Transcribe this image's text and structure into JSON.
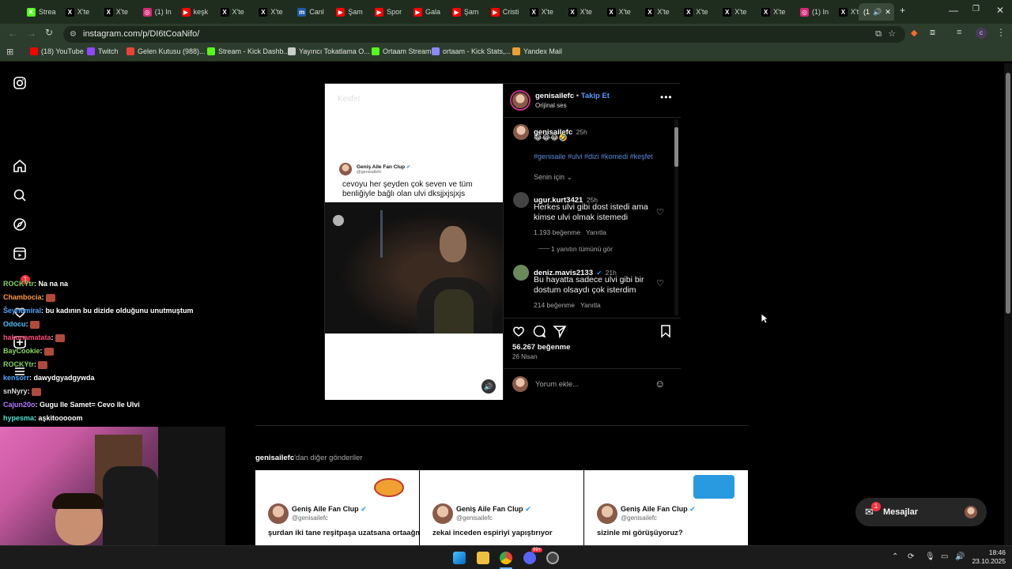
{
  "browser": {
    "tabs": [
      {
        "label": "Strea",
        "icon": "kick-icon",
        "color": "#53fc18"
      },
      {
        "label": "X'te",
        "icon": "x-icon",
        "color": "#000000"
      },
      {
        "label": "X'te",
        "icon": "x-icon",
        "color": "#000000"
      },
      {
        "label": "(1) In",
        "icon": "instagram-icon",
        "color": "#d62976"
      },
      {
        "label": "keşk",
        "icon": "youtube-icon",
        "color": "#ff0000"
      },
      {
        "label": "X'te",
        "icon": "x-icon",
        "color": "#000000"
      },
      {
        "label": "X'te",
        "icon": "x-icon",
        "color": "#000000"
      },
      {
        "label": "Canl",
        "icon": "mackolik-icon",
        "color": "#1e5aa8"
      },
      {
        "label": "Şam",
        "icon": "youtube-icon",
        "color": "#ff0000"
      },
      {
        "label": "Spor",
        "icon": "youtube-icon",
        "color": "#ff0000"
      },
      {
        "label": "Gala",
        "icon": "youtube-icon",
        "color": "#ff0000"
      },
      {
        "label": "Şam",
        "icon": "youtube-icon",
        "color": "#ff0000"
      },
      {
        "label": "Cristi",
        "icon": "youtube-icon",
        "color": "#ff0000"
      },
      {
        "label": "X'te",
        "icon": "x-icon",
        "color": "#000000"
      },
      {
        "label": "X'te",
        "icon": "x-icon",
        "color": "#000000"
      },
      {
        "label": "X'te",
        "icon": "x-icon",
        "color": "#000000"
      },
      {
        "label": "X'te",
        "icon": "x-icon",
        "color": "#000000"
      },
      {
        "label": "X'te",
        "icon": "x-icon",
        "color": "#000000"
      },
      {
        "label": "X'te",
        "icon": "x-icon",
        "color": "#000000"
      },
      {
        "label": "X'te",
        "icon": "x-icon",
        "color": "#000000"
      },
      {
        "label": "(1) In",
        "icon": "instagram-icon",
        "color": "#d62976"
      },
      {
        "label": "X'te",
        "icon": "x-icon",
        "color": "#000000"
      }
    ],
    "active_tab_label": "(1",
    "url": "instagram.com/p/DI6tCoaNifo/",
    "bookmarks": [
      {
        "label": "(18) YouTube",
        "color": "#ff0000"
      },
      {
        "label": "Twitch",
        "color": "#9146ff"
      },
      {
        "label": "Gelen Kutusu (988)...",
        "color": "#ea4335"
      },
      {
        "label": "Stream - Kick Dashb...",
        "color": "#53fc18"
      },
      {
        "label": "Yayıncı Tokatlama O...",
        "color": "#cccccc"
      },
      {
        "label": "Ortaam Stream",
        "color": "#53fc18"
      },
      {
        "label": "ortaam - Kick Stats,...",
        "color": "#8a8aff"
      },
      {
        "label": "Yandex Mail",
        "color": "#f0a030"
      }
    ]
  },
  "post": {
    "username": "genisailefc",
    "follow_label": "Takip Et",
    "audio": "Orijinal ses",
    "caption_time": "25h",
    "caption_emojis": "😂😂😂🤣",
    "hashtags": "#genisaile #ulvi #dizi #komedi #keşfet",
    "for_you": "Senin için",
    "comments": [
      {
        "user": "ugur.kurt3421",
        "time": "25h",
        "text": "Herkes ulvi gibi dost istedi ama kimse ulvi olmak istemedi",
        "likes": "1.193 beğenme",
        "reply": "Yanıtla",
        "view_replies": "1 yanıtın tümünü gör"
      },
      {
        "user": "deniz.mavis2133",
        "time": "21h",
        "text": "Bu hayatta sadece ulvi gibi bir dostum olsaydı çok isterdim",
        "likes": "214 beğenme",
        "reply": "Yanıtla"
      }
    ],
    "likes": "56.267 beğenme",
    "date": "26 Nisan",
    "comment_placeholder": "Yorum ekle...",
    "media": {
      "watermark": "Kesfet",
      "tweet_name": "Geniş Aile Fan Clup",
      "tweet_handle": "@genisailefc",
      "tweet_text": "cevoyu her şeyden çok seven ve tüm benliğiyle bağlı olan ulvi dksjjxjsjxjs"
    }
  },
  "more_posts": {
    "title_user": "genisailefc",
    "title_suffix": "'dan diğer gönderiler",
    "items": [
      {
        "name": "Geniş Aile Fan Clup",
        "handle": "@genisailefc",
        "text": "şurdan iki tane reşitpaşa uzatsana ortaağm"
      },
      {
        "name": "Geniş Aile Fan Clup",
        "handle": "@genisailefc",
        "text": "zekai inceden espiriyi yapıştırıyor"
      },
      {
        "name": "Geniş Aile Fan Clup",
        "handle": "@genisailefc",
        "text": "sizinle mi görüşüyoruz?"
      }
    ]
  },
  "messages": {
    "label": "Mesajlar",
    "badge": "1"
  },
  "sidebar_badge": "1",
  "chat": [
    {
      "user": "ROCKYtr",
      "color": "#7fd65a",
      "text": ": Na na na"
    },
    {
      "user": "Chambocia",
      "color": "#ff9a3a",
      "text": ":"
    },
    {
      "user": "Ŝeynemiral",
      "color": "#4ea6ff",
      "text": ": bu kadının bu dizide olduğunu unutmuştum"
    },
    {
      "user": "Odocu",
      "color": "#4ec4ff",
      "text": ":"
    },
    {
      "user": "hakunamatata",
      "color": "#ff4a7a",
      "text": ":"
    },
    {
      "user": "BayCookie",
      "color": "#8ad65a",
      "text": ":"
    },
    {
      "user": "ROCKYtr",
      "color": "#7fd65a",
      "text": ":"
    },
    {
      "user": "kensorr",
      "color": "#4ea6ff",
      "text": ": dawydgyadgywda"
    },
    {
      "user": "snNyry",
      "color": "#dddddd",
      "text": ":"
    },
    {
      "user": "Cajun20o",
      "color": "#b57aff",
      "text": ": Gugu Ile Samet= Cevo Ile Ulvi"
    },
    {
      "user": "hypesma",
      "color": "#4ee0d0",
      "text": ": aşkitooooom"
    }
  ],
  "taskbar": {
    "time": "18:46",
    "date": "23.10.2025",
    "discord_badge": "99+"
  }
}
